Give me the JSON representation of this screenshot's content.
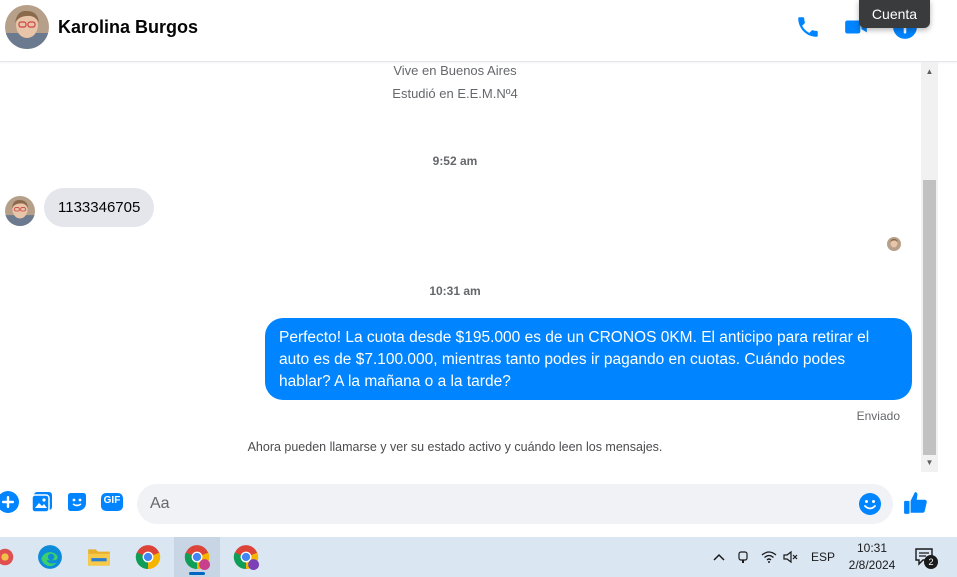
{
  "header": {
    "contact_name": "Karolina Burgos",
    "tooltip": "Cuenta",
    "icons": [
      "phone-icon",
      "video-icon",
      "info-icon"
    ]
  },
  "profile": {
    "lives_in": "Vive en Buenos Aires",
    "studied_at": "Estudió en E.E.M.Nº4"
  },
  "messages": [
    {
      "type": "timestamp",
      "text": "9:52 am"
    },
    {
      "type": "incoming",
      "text": "1133346705"
    },
    {
      "type": "timestamp",
      "text": "10:31 am"
    },
    {
      "type": "outgoing",
      "text": "Perfecto! La cuota desde $195.000 es de un CRONOS 0KM. El anticipo para retirar el auto es de $7.100.000, mientras tanto podes ir pagando en cuotas. Cuándo podes hablar? A la mañana o a la tarde?"
    }
  ],
  "status": {
    "sent": "Enviado",
    "notice": "Ahora pueden llamarse y ver su estado activo y cuándo leen los mensajes."
  },
  "composer": {
    "placeholder": "Aa",
    "gif_label": "GIF",
    "icons": [
      "plus-icon",
      "photo-icon",
      "sticker-icon",
      "gif-icon",
      "emoji-icon",
      "like-icon"
    ]
  },
  "taskbar": {
    "language": "ESP",
    "time": "10:31",
    "date": "2/8/2024",
    "notification_count": "2"
  },
  "colors": {
    "accent": "#0084ff",
    "incoming_bubble": "#e4e6eb",
    "taskbar": "#dbe6f3"
  }
}
